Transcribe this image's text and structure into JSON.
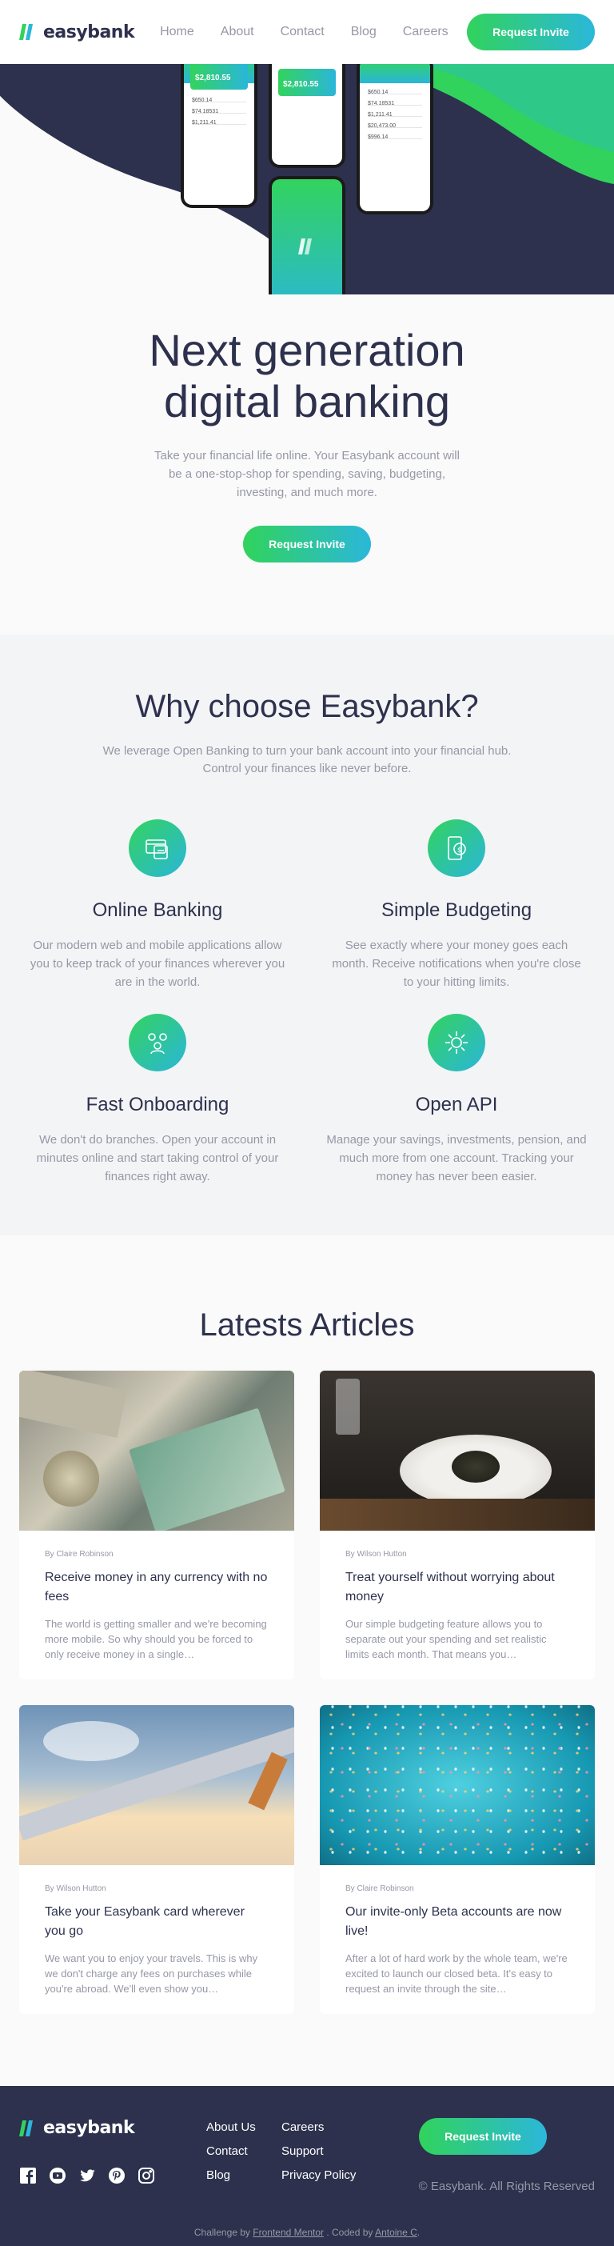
{
  "brand": {
    "name": "easybank"
  },
  "nav": {
    "items": [
      "Home",
      "About",
      "Contact",
      "Blog",
      "Careers"
    ]
  },
  "header": {
    "cta": "Request Invite"
  },
  "phones": {
    "balance": "$2,810.55",
    "rows": [
      "$650.14",
      "$74.18531",
      "$1,211.41",
      "$20,473.00",
      "$996.14"
    ]
  },
  "hero": {
    "title_line1": "Next generation",
    "title_line2": "digital banking",
    "text": "Take your financial life online. Your Easybank account will be a one-stop-shop for spending, saving, budgeting, investing, and much more.",
    "cta": "Request Invite"
  },
  "why": {
    "title": "Why choose Easybank?",
    "text": "We leverage Open Banking to turn your bank account into your financial hub. Control your finances like never before.",
    "features": [
      {
        "icon": "online-banking-icon",
        "title": "Online Banking",
        "text": "Our modern web and mobile applications allow you to keep track of your finances wherever you are in the world."
      },
      {
        "icon": "budgeting-icon",
        "title": "Simple Budgeting",
        "text": "See exactly where your money goes each month. Receive notifications when you're close to your hitting limits."
      },
      {
        "icon": "onboarding-icon",
        "title": "Fast Onboarding",
        "text": "We don't do branches. Open your account in minutes online and start taking control of your finances right away."
      },
      {
        "icon": "api-icon",
        "title": "Open API",
        "text": "Manage your savings, investments, pension, and much more from one account. Tracking your money has never been easier."
      }
    ]
  },
  "articles": {
    "title": "Latests Articles",
    "items": [
      {
        "author": "By Claire Robinson",
        "title": "Receive money in any currency with no fees",
        "excerpt": "The world is getting smaller and we're becoming more mobile. So why should you be forced to only receive money in a single…"
      },
      {
        "author": "By Wilson Hutton",
        "title": "Treat yourself without worrying about money",
        "excerpt": "Our simple budgeting feature allows you to separate out your spending and set realistic limits each month. That means you…"
      },
      {
        "author": "By Wilson Hutton",
        "title": "Take your Easybank card wherever you go",
        "excerpt": "We want you to enjoy your travels. This is why we don't charge any fees on purchases while you're abroad. We'll even show you…"
      },
      {
        "author": "By Claire Robinson",
        "title": "Our invite-only Beta accounts are now live!",
        "excerpt": "After a lot of hard work by the whole team, we're excited to launch our closed beta. It's easy to request an invite through the site…"
      }
    ]
  },
  "footer": {
    "links": [
      "About Us",
      "Careers",
      "Contact",
      "Support",
      "Blog",
      "Privacy Policy"
    ],
    "cta": "Request Invite",
    "copyright": "© Easybank. All Rights Reserved",
    "attribution_prefix": "Challenge by",
    "attribution_fm": "Frontend Mentor",
    "attribution_mid": ". Coded by",
    "attribution_author": "Antoine C",
    "attribution_end": "."
  },
  "colors": {
    "dark_blue": "#2d314d",
    "lime": "#31d35c",
    "cyan": "#2bb7da",
    "grey": "#9698a6"
  }
}
